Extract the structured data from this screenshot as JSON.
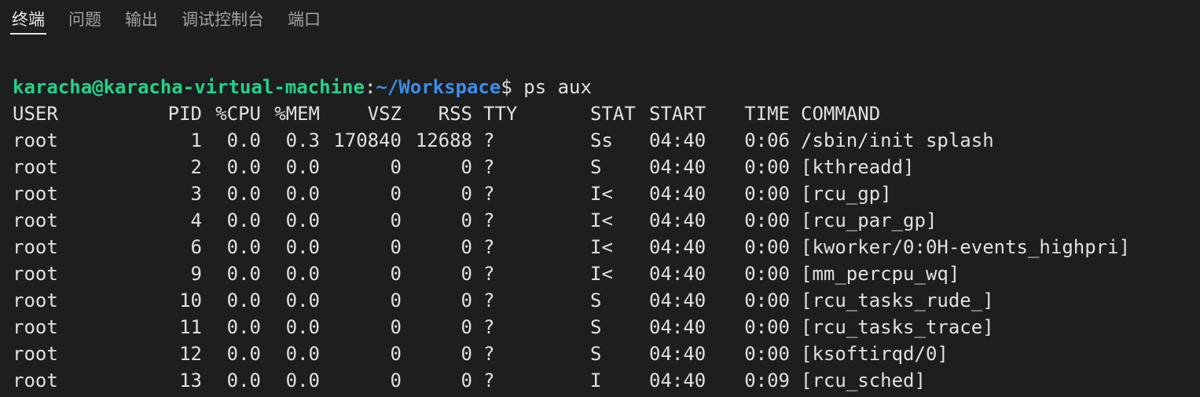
{
  "colors": {
    "background": "#1e1e1e",
    "prompt_user": "#23d18b",
    "prompt_path": "#3b8eea",
    "text": "#e0e0e0"
  },
  "tabs": [
    {
      "label": "终端",
      "active": true
    },
    {
      "label": "问题",
      "active": false
    },
    {
      "label": "输出",
      "active": false
    },
    {
      "label": "调试控制台",
      "active": false
    },
    {
      "label": "端口",
      "active": false
    }
  ],
  "terminal": {
    "prompt": {
      "user_host": "karacha@karacha-virtual-machine",
      "colon": ":",
      "path": "~/Workspace",
      "symbol": "$",
      "command": " ps aux"
    },
    "headers": [
      "USER",
      "PID",
      "%CPU",
      "%MEM",
      "VSZ",
      "RSS",
      "TTY",
      "STAT",
      "START",
      "TIME",
      "COMMAND"
    ],
    "rows": [
      [
        "root",
        "1",
        "0.0",
        "0.3",
        "170840",
        "12688",
        "?",
        "Ss",
        "04:40",
        "0:06",
        "/sbin/init splash"
      ],
      [
        "root",
        "2",
        "0.0",
        "0.0",
        "0",
        "0",
        "?",
        "S",
        "04:40",
        "0:00",
        "[kthreadd]"
      ],
      [
        "root",
        "3",
        "0.0",
        "0.0",
        "0",
        "0",
        "?",
        "I<",
        "04:40",
        "0:00",
        "[rcu_gp]"
      ],
      [
        "root",
        "4",
        "0.0",
        "0.0",
        "0",
        "0",
        "?",
        "I<",
        "04:40",
        "0:00",
        "[rcu_par_gp]"
      ],
      [
        "root",
        "6",
        "0.0",
        "0.0",
        "0",
        "0",
        "?",
        "I<",
        "04:40",
        "0:00",
        "[kworker/0:0H-events_highpri]"
      ],
      [
        "root",
        "9",
        "0.0",
        "0.0",
        "0",
        "0",
        "?",
        "I<",
        "04:40",
        "0:00",
        "[mm_percpu_wq]"
      ],
      [
        "root",
        "10",
        "0.0",
        "0.0",
        "0",
        "0",
        "?",
        "S",
        "04:40",
        "0:00",
        "[rcu_tasks_rude_]"
      ],
      [
        "root",
        "11",
        "0.0",
        "0.0",
        "0",
        "0",
        "?",
        "S",
        "04:40",
        "0:00",
        "[rcu_tasks_trace]"
      ],
      [
        "root",
        "12",
        "0.0",
        "0.0",
        "0",
        "0",
        "?",
        "S",
        "04:40",
        "0:00",
        "[ksoftirqd/0]"
      ],
      [
        "root",
        "13",
        "0.0",
        "0.0",
        "0",
        "0",
        "?",
        "I",
        "04:40",
        "0:09",
        "[rcu_sched]"
      ]
    ]
  }
}
